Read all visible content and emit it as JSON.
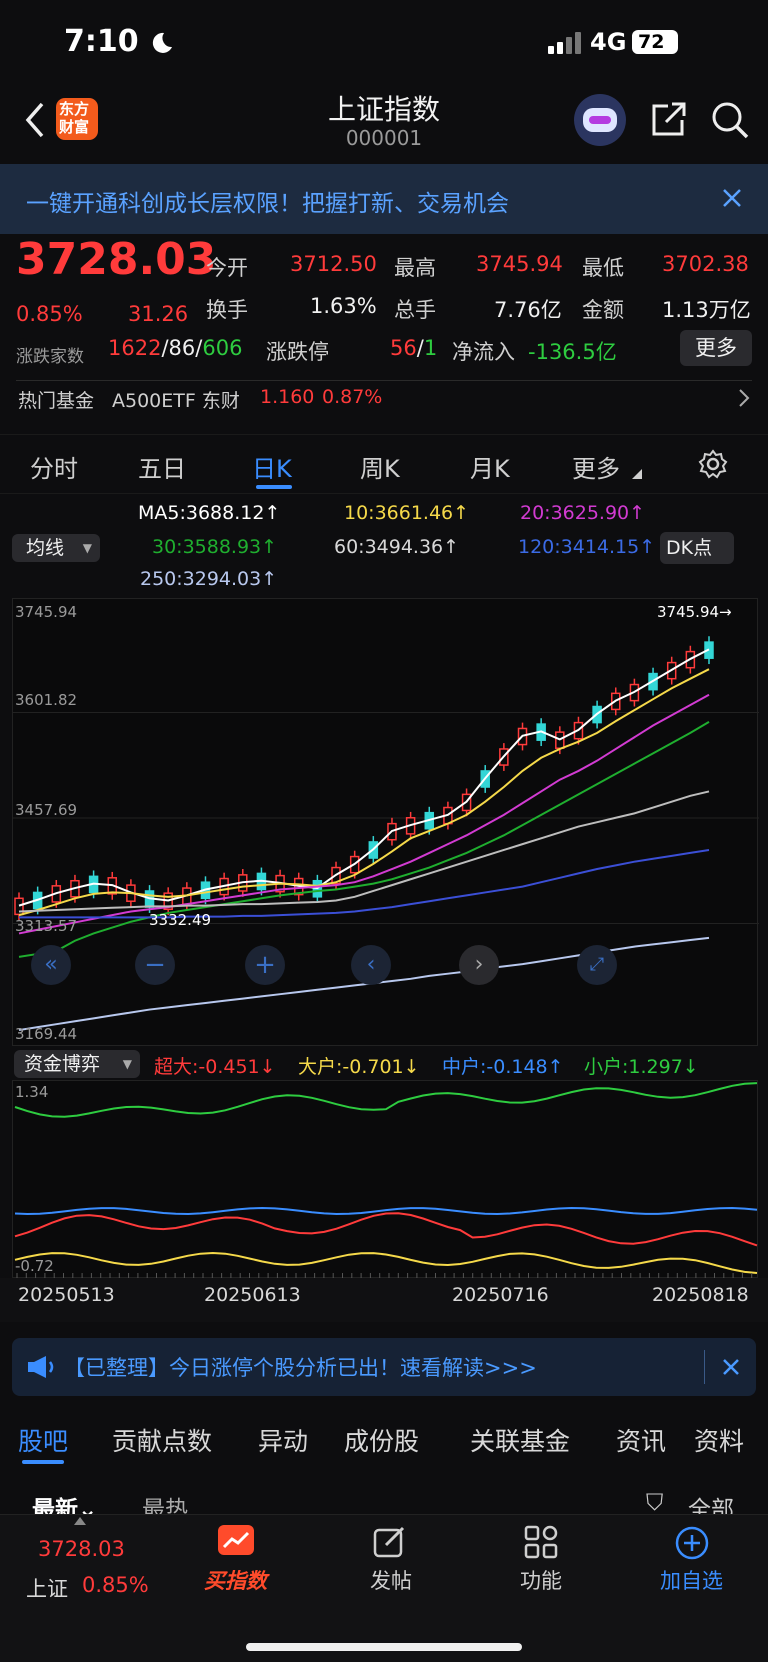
{
  "status": {
    "time": "7:10",
    "network": "4G",
    "battery": "72"
  },
  "nav": {
    "title": "上证指数",
    "code": "000001",
    "logo_line1": "东方",
    "logo_line2": "财富"
  },
  "banner": {
    "text": "一键开通科创成长层权限！把握打新、交易机会"
  },
  "quote": {
    "price": "3728.03",
    "change_pct": "0.85%",
    "change": "31.26",
    "open_label": "今开",
    "open": "3712.50",
    "high_label": "最高",
    "high": "3745.94",
    "low_label": "最低",
    "low": "3702.38",
    "turnover_label": "换手",
    "turnover": "1.63%",
    "volume_label": "总手",
    "volume": "7.76亿",
    "amount_label": "金额",
    "amount": "1.13万亿",
    "breadth_label": "涨跌家数",
    "up_count": "1622",
    "flat_count": "86",
    "down_count": "606",
    "limit_label": "涨跌停",
    "limit_up": "56",
    "limit_down": "1",
    "netflow_label": "净流入",
    "netflow": "-136.5亿",
    "more_label": "更多",
    "fund_label": "热门基金",
    "fund_name": "A500ETF 东财",
    "fund_price": "1.160",
    "fund_pct": "0.87%"
  },
  "tabs": {
    "items": [
      "分时",
      "五日",
      "日K",
      "周K",
      "月K",
      "更多"
    ],
    "active": "日K"
  },
  "ma": {
    "selector": "均线",
    "ma5": "MA5:3688.12",
    "ma10": "10:3661.46",
    "ma20": "20:3625.90",
    "ma30": "30:3588.93",
    "ma60": "60:3494.36",
    "ma120": "120:3414.15",
    "ma250": "250:3294.03",
    "dk_label": "DK点"
  },
  "colors": {
    "up": "#ff3b3b",
    "down": "#2ecc40",
    "accent": "#3a8dff",
    "ma5": "#ffffff",
    "ma10": "#f5d94a",
    "ma20": "#d23bd2",
    "ma30": "#1fae2f",
    "ma60": "#bdbdbd",
    "ma120": "#3b4fd6",
    "ma250": "#b8c8ee"
  },
  "chart_data": {
    "type": "line",
    "title": "",
    "y_labels": [
      "3745.94",
      "3601.82",
      "3457.69",
      "3313.57",
      "3169.44"
    ],
    "max_label": "3745.94",
    "min_label": "3332.49",
    "ylim": [
      3169.44,
      3745.94
    ],
    "x_labels": [
      "20250513",
      "20250613",
      "20250716",
      "20250818"
    ],
    "series": [
      {
        "name": "MA5:3688.12",
        "values": [
          3338,
          3346,
          3355,
          3362,
          3368,
          3366,
          3356,
          3348,
          3345,
          3352,
          3360,
          3365,
          3370,
          3372,
          3369,
          3365,
          3362,
          3380,
          3395,
          3415,
          3440,
          3448,
          3455,
          3462,
          3480,
          3512,
          3542,
          3570,
          3576,
          3565,
          3578,
          3600,
          3618,
          3630,
          3645,
          3660,
          3675,
          3688
        ]
      },
      {
        "name": "10:3661.46",
        "values": [
          3325,
          3332,
          3340,
          3348,
          3354,
          3356,
          3355,
          3352,
          3350,
          3352,
          3356,
          3360,
          3364,
          3366,
          3368,
          3367,
          3365,
          3370,
          3380,
          3395,
          3412,
          3430,
          3440,
          3450,
          3462,
          3480,
          3500,
          3522,
          3540,
          3552,
          3562,
          3574,
          3590,
          3605,
          3620,
          3635,
          3648,
          3661
        ]
      },
      {
        "name": "20:3625.90",
        "values": [
          3300,
          3305,
          3310,
          3315,
          3320,
          3325,
          3330,
          3333,
          3336,
          3340,
          3344,
          3348,
          3352,
          3356,
          3360,
          3362,
          3364,
          3366,
          3370,
          3378,
          3388,
          3398,
          3410,
          3422,
          3434,
          3448,
          3462,
          3478,
          3494,
          3510,
          3522,
          3536,
          3552,
          3568,
          3584,
          3598,
          3612,
          3626
        ]
      },
      {
        "name": "30:3588.93",
        "values": [
          3268,
          3272,
          3276,
          3290,
          3300,
          3308,
          3316,
          3322,
          3328,
          3332,
          3336,
          3340,
          3344,
          3348,
          3352,
          3355,
          3358,
          3360,
          3364,
          3368,
          3374,
          3382,
          3390,
          3400,
          3410,
          3422,
          3434,
          3448,
          3462,
          3476,
          3490,
          3504,
          3518,
          3532,
          3546,
          3560,
          3574,
          3589
        ]
      },
      {
        "name": "60:3494.36",
        "values": [
          3330,
          3331,
          3332,
          3333,
          3334,
          3335,
          3336,
          3337,
          3337,
          3338,
          3338,
          3339,
          3340,
          3340,
          3341,
          3342,
          3343,
          3345,
          3350,
          3358,
          3366,
          3374,
          3382,
          3390,
          3398,
          3406,
          3414,
          3422,
          3430,
          3438,
          3446,
          3452,
          3458,
          3464,
          3472,
          3480,
          3488,
          3494
        ]
      },
      {
        "name": "120:3414.15",
        "values": [
          3322,
          3322,
          3322,
          3322,
          3322,
          3322,
          3322,
          3322,
          3322,
          3323,
          3323,
          3323,
          3324,
          3324,
          3325,
          3326,
          3327,
          3328,
          3330,
          3333,
          3336,
          3340,
          3344,
          3348,
          3352,
          3356,
          3360,
          3364,
          3370,
          3376,
          3382,
          3388,
          3393,
          3398,
          3402,
          3406,
          3410,
          3414
        ]
      },
      {
        "name": "250:3294.03",
        "values": [
          3168,
          3172,
          3176,
          3180,
          3184,
          3188,
          3192,
          3196,
          3199,
          3202,
          3205,
          3208,
          3211,
          3214,
          3217,
          3220,
          3223,
          3226,
          3229,
          3232,
          3235,
          3238,
          3242,
          3245,
          3248,
          3252,
          3255,
          3258,
          3262,
          3266,
          3270,
          3274,
          3278,
          3282,
          3285,
          3288,
          3291,
          3294
        ]
      }
    ]
  },
  "flow": {
    "selector": "资金博弈",
    "super_label": "超大:-0.451↓",
    "large_label": "大户:-0.701↓",
    "medium_label": "中户:-0.148↑",
    "small_label": "小户:1.297↓",
    "ymax": "1.34",
    "ymin": "-0.72"
  },
  "notice": {
    "text": "【已整理】今日涨停个股分析已出！速看解读>>>"
  },
  "subtabs": {
    "items": [
      "股吧",
      "贡献点数",
      "异动",
      "成份股",
      "关联基金",
      "资讯",
      "资料"
    ],
    "active": "股吧",
    "sort_new": "最新",
    "sort_hot": "最热",
    "filter_all": "全部"
  },
  "bottom": {
    "price": "3728.03",
    "name": "上证",
    "pct": "0.85%",
    "buy": "买指数",
    "post": "发帖",
    "func": "功能",
    "add": "加自选"
  }
}
